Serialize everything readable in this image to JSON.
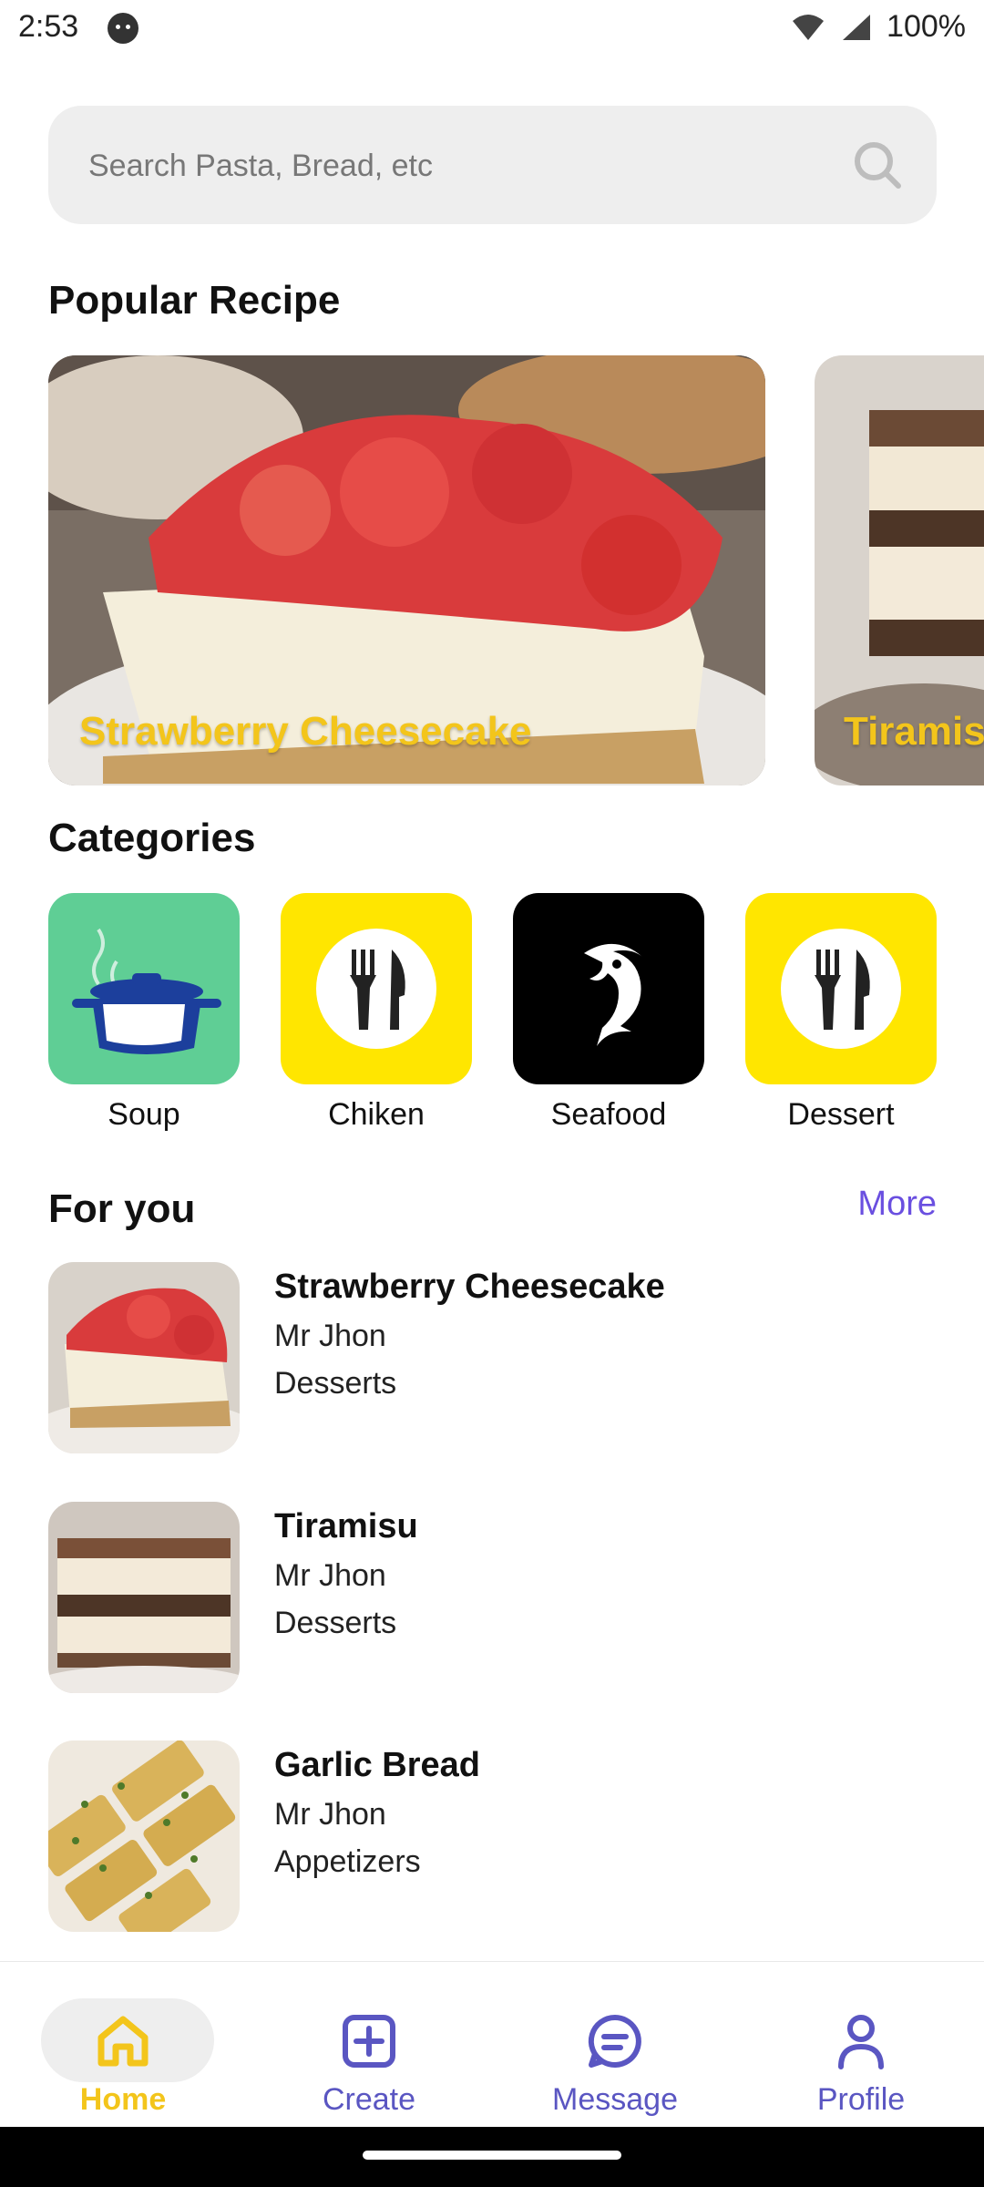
{
  "status_bar": {
    "time": "2:53",
    "battery": "100%"
  },
  "search": {
    "placeholder": "Search Pasta, Bread, etc"
  },
  "popular": {
    "title": "Popular Recipe",
    "cards": [
      {
        "title": "Strawberry Cheesecake"
      },
      {
        "title": "Tiramisu"
      }
    ]
  },
  "categories": {
    "title": "Categories",
    "items": [
      {
        "label": "Soup",
        "icon": "pot-icon",
        "color": "#5fce95"
      },
      {
        "label": "Chiken",
        "icon": "fork-knife-icon",
        "color": "#ffe600"
      },
      {
        "label": "Seafood",
        "icon": "fish-icon",
        "color": "#000000"
      },
      {
        "label": "Dessert",
        "icon": "fork-knife-icon",
        "color": "#ffe600"
      }
    ]
  },
  "for_you": {
    "title": "For you",
    "more": "More",
    "items": [
      {
        "title": "Strawberry Cheesecake",
        "author": "Mr Jhon",
        "category": "Desserts"
      },
      {
        "title": "Tiramisu",
        "author": "Mr Jhon",
        "category": "Desserts"
      },
      {
        "title": "Garlic Bread",
        "author": "Mr Jhon",
        "category": "Appetizers"
      }
    ]
  },
  "nav": {
    "items": [
      {
        "label": "Home",
        "icon": "home-icon",
        "active": true
      },
      {
        "label": "Create",
        "icon": "plus-square-icon",
        "active": false
      },
      {
        "label": "Message",
        "icon": "message-icon",
        "active": false
      },
      {
        "label": "Profile",
        "icon": "person-icon",
        "active": false
      }
    ]
  },
  "colors": {
    "accent": "#f3c51b",
    "nav_inactive": "#5a56c2",
    "more_link": "#6a4fe0"
  }
}
